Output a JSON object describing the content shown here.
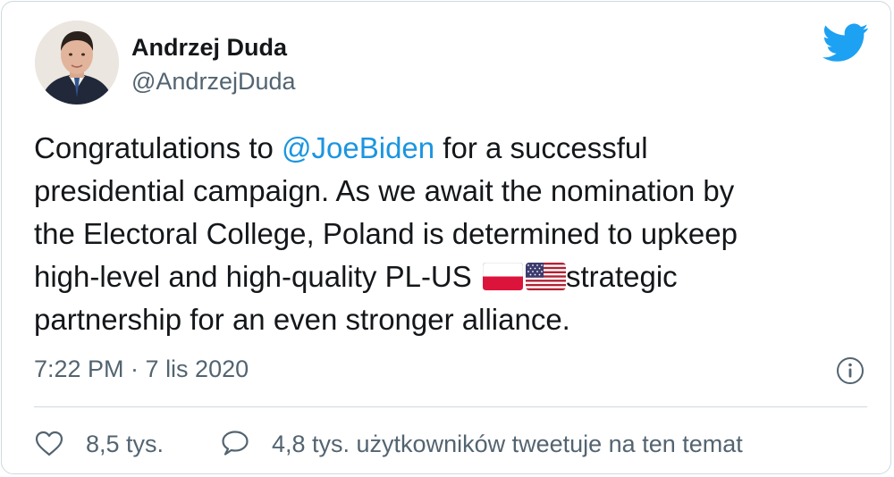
{
  "author": {
    "name": "Andrzej Duda",
    "handle": "@AndrzejDuda"
  },
  "tweet": {
    "text_before_mention": "Congratulations to ",
    "mention": "@JoeBiden",
    "line1_rest": " for a successful",
    "line2": "presidential campaign. As we await the nomination by",
    "line3": "the Electoral College, Poland is determined to upkeep",
    "line4_before_flags": "high-level and high-quality PL-US ",
    "line4_after_flags": "strategic",
    "line5": "partnership for an even stronger alliance.",
    "flags": [
      "poland-flag-icon",
      "us-flag-icon"
    ]
  },
  "meta": {
    "timestamp": "7:22 PM · 7 lis 2020"
  },
  "actions": {
    "likes_count": "8,5 tys.",
    "conversation_text": "4,8 tys. użytkowników tweetuje na ten temat"
  },
  "icons": {
    "brand": "twitter-bird-icon",
    "info": "info-icon",
    "like": "heart-icon",
    "reply": "speech-bubble-icon"
  },
  "colors": {
    "brand": "#1da1f2",
    "mention": "#1b95e0",
    "secondary_text": "#536471",
    "border": "#cfd9de"
  }
}
